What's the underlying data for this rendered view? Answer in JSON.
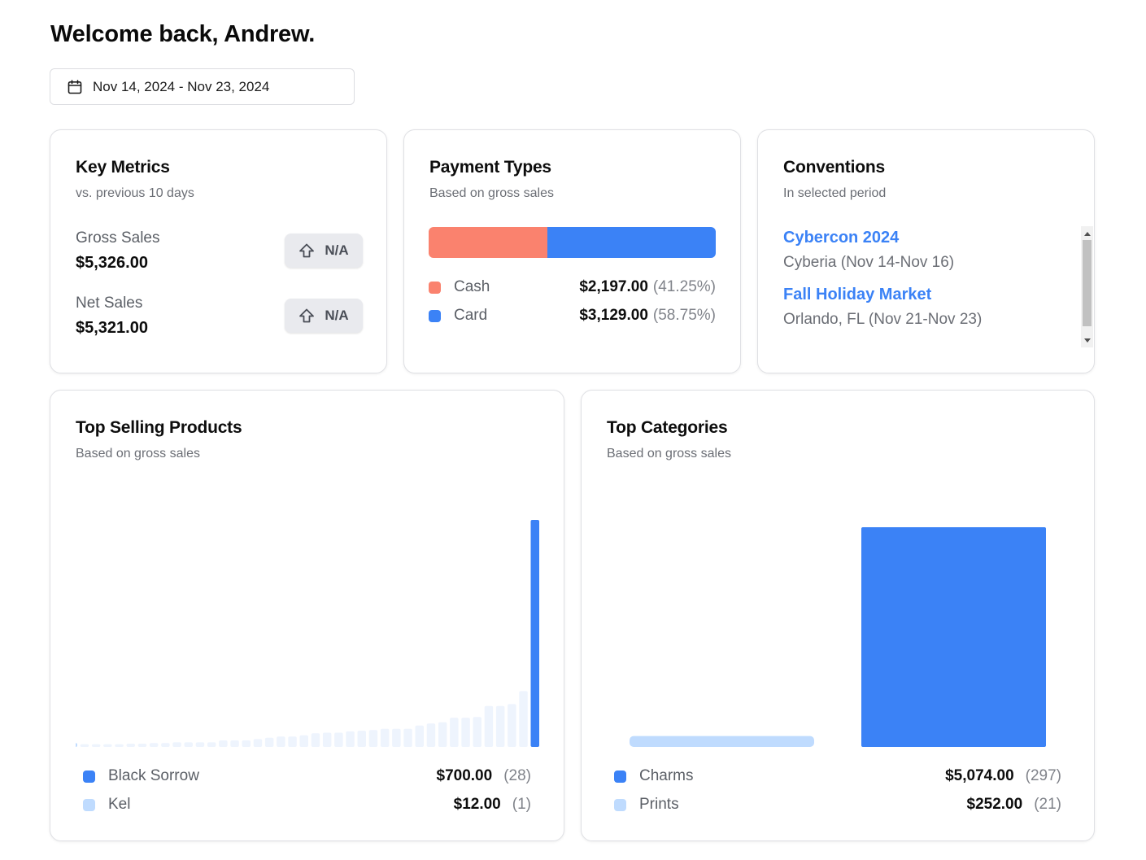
{
  "header": {
    "welcome": "Welcome back, Andrew.",
    "date_range": "Nov 14, 2024 - Nov 23, 2024"
  },
  "key_metrics": {
    "title": "Key Metrics",
    "subtitle": "vs. previous 10 days",
    "gross_label": "Gross Sales",
    "gross_value": "$5,326.00",
    "gross_change": "N/A",
    "net_label": "Net Sales",
    "net_value": "$5,321.00",
    "net_change": "N/A"
  },
  "payment_types": {
    "title": "Payment Types",
    "subtitle": "Based on gross sales",
    "items": [
      {
        "name": "Cash",
        "amount": "$2,197.00",
        "percent": "(41.25%)",
        "share": 41.25,
        "color": "#fa826e"
      },
      {
        "name": "Card",
        "amount": "$3,129.00",
        "percent": "(58.75%)",
        "share": 58.75,
        "color": "#3b82f6"
      }
    ]
  },
  "conventions": {
    "title": "Conventions",
    "subtitle": "In selected period",
    "items": [
      {
        "name": "Cybercon 2024",
        "info": "Cyberia (Nov 14-Nov 16)"
      },
      {
        "name": "Fall Holiday Market",
        "info": "Orlando, FL (Nov 21-Nov 23)"
      }
    ]
  },
  "top_products": {
    "title": "Top Selling Products",
    "subtitle": "Based on gross sales",
    "legend": [
      {
        "name": "Black Sorrow",
        "amount": "$700.00",
        "count": "(28)",
        "color": "#3b82f6"
      },
      {
        "name": "Kel",
        "amount": "$12.00",
        "count": "(1)",
        "color": "#bfdbfe"
      }
    ]
  },
  "top_categories": {
    "title": "Top Categories",
    "subtitle": "Based on gross sales",
    "legend": [
      {
        "name": "Charms",
        "amount": "$5,074.00",
        "count": "(297)",
        "color": "#3b82f6"
      },
      {
        "name": "Prints",
        "amount": "$252.00",
        "count": "(21)",
        "color": "#bfdbfe"
      }
    ]
  },
  "colors": {
    "accent": "#3b82f6",
    "accent_light": "#bfdbfe",
    "bar_faint": "#eef4fd",
    "cash": "#fa826e"
  },
  "icons": {
    "date_picker": "calendar-icon",
    "change_badge": "arrow-up-icon"
  },
  "chart_data": [
    {
      "type": "bar",
      "values": [
        12,
        8,
        8,
        8,
        8,
        10,
        10,
        12,
        12,
        14,
        14,
        14,
        14,
        20,
        20,
        20,
        24,
        28,
        32,
        32,
        36,
        42,
        44,
        44,
        48,
        50,
        52,
        56,
        56,
        56,
        66,
        72,
        76,
        90,
        90,
        92,
        126,
        126,
        132,
        172,
        700
      ],
      "highlight_index": 40,
      "ylim": [
        0,
        700
      ]
    },
    {
      "type": "bar",
      "categories": [
        "Prints",
        "Charms"
      ],
      "values": [
        252,
        5074
      ],
      "ylim": [
        0,
        5074
      ]
    }
  ]
}
